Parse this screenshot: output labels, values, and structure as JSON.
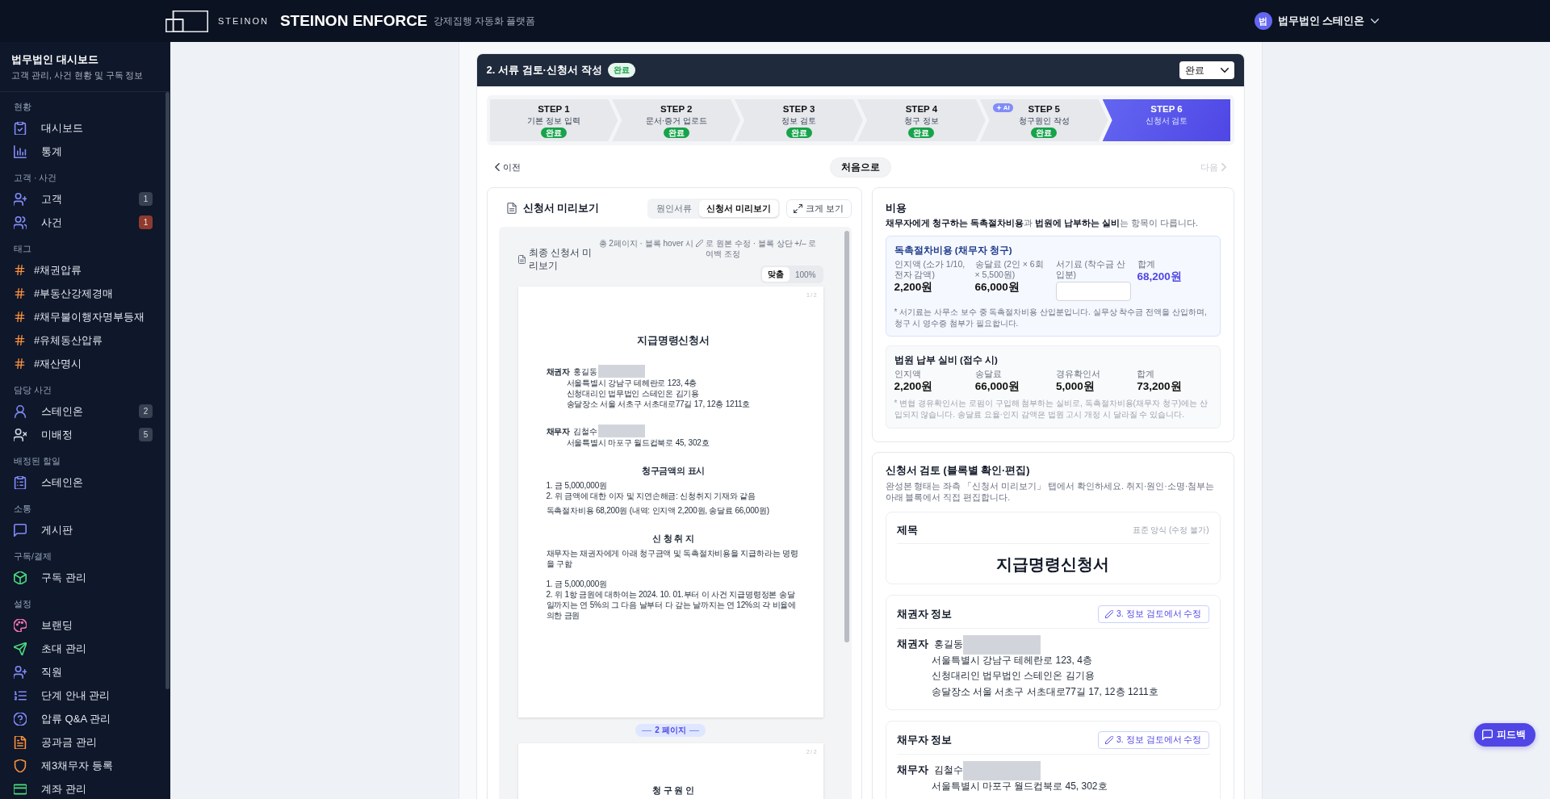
{
  "topbar": {
    "brand": "STEINON",
    "product": "STEINON ENFORCE",
    "tagline": "강제집행 자동화 플랫폼",
    "user": {
      "initial": "법",
      "name": "법무법인 스테인온"
    }
  },
  "sidebar": {
    "title": "법무법인 대시보드",
    "subtitle": "고객 관리, 사건 현황 및 구독 정보",
    "sections": [
      {
        "heading": "현황",
        "items": [
          {
            "kind": "dashboard",
            "label": "대시보드",
            "selected": false
          },
          {
            "kind": "stats",
            "label": "통계",
            "selected": false
          }
        ]
      },
      {
        "heading": "고객 · 사건",
        "items": [
          {
            "kind": "clients",
            "label": "고객",
            "selected": false,
            "badge": {
              "text": "1",
              "kind": "neutral"
            }
          },
          {
            "kind": "cases",
            "label": "사건",
            "selected": false,
            "badge": {
              "text": "1",
              "kind": "alert"
            }
          }
        ]
      },
      {
        "heading": "태그",
        "items": [
          {
            "kind": "tag",
            "label": "#채권압류",
            "selected": false
          },
          {
            "kind": "tag",
            "label": "#부동산강제경매",
            "selected": false
          },
          {
            "kind": "tag",
            "label": "#채무불이행자명부등재",
            "selected": false
          },
          {
            "kind": "tag",
            "label": "#유체동산압류",
            "selected": false
          },
          {
            "kind": "tag",
            "label": "#재산명시",
            "selected": false
          }
        ]
      },
      {
        "heading": "담당 사건",
        "items": [
          {
            "kind": "assignee",
            "label": "스테인온",
            "selected": false,
            "badge": {
              "text": "2",
              "kind": "neutral"
            }
          },
          {
            "kind": "unassigned",
            "label": "미배정",
            "selected": false,
            "badge": {
              "text": "5",
              "kind": "neutral"
            }
          }
        ]
      },
      {
        "heading": "배정된 할일",
        "items": [
          {
            "kind": "tasks",
            "label": "스테인온",
            "selected": false
          }
        ]
      },
      {
        "heading": "소통",
        "items": [
          {
            "kind": "board",
            "label": "게시판",
            "selected": false
          }
        ]
      },
      {
        "heading": "구독/결제",
        "items": [
          {
            "kind": "subscription",
            "label": "구독 관리",
            "selected": false
          }
        ]
      },
      {
        "heading": "설정",
        "items": [
          {
            "kind": "branding",
            "label": "브랜딩",
            "selected": false
          },
          {
            "kind": "invite",
            "label": "초대 관리",
            "selected": false
          },
          {
            "kind": "staff",
            "label": "직원",
            "selected": false
          },
          {
            "kind": "step-guide",
            "label": "단계 안내 관리",
            "selected": false
          },
          {
            "kind": "qa",
            "label": "압류 Q&A 관리",
            "selected": false
          },
          {
            "kind": "bills",
            "label": "공과금 관리",
            "selected": false
          },
          {
            "kind": "third-debtor",
            "label": "제3채무자 등록",
            "selected": false
          },
          {
            "kind": "accounts",
            "label": "계좌 관리",
            "selected": false
          }
        ]
      }
    ]
  },
  "workflow": {
    "title": "2. 서류 검토·신청서 작성",
    "status_badge": "완료",
    "status_select": {
      "value": "완료"
    },
    "steps": [
      {
        "label": "STEP 1",
        "title": "기본 정보 입력",
        "status": "완료",
        "selected": false
      },
      {
        "label": "STEP 2",
        "title": "문서·증거 업로드",
        "status": "완료",
        "selected": false
      },
      {
        "label": "STEP 3",
        "title": "정보 검토",
        "status": "완료",
        "selected": false
      },
      {
        "label": "STEP 4",
        "title": "청구 정보",
        "status": "완료",
        "selected": false
      },
      {
        "label": "STEP 5",
        "title": "청구원인 작성",
        "status": "완료",
        "selected": false,
        "ai_tag": "AI"
      },
      {
        "label": "STEP 6",
        "title": "신청서 검토",
        "selected": true
      }
    ],
    "nav": {
      "prev": {
        "label": "이전",
        "disabled": false
      },
      "home": {
        "label": "처음으로"
      },
      "next": {
        "label": "다음",
        "disabled": true
      }
    }
  },
  "preview_panel": {
    "title": "신청서 미리보기",
    "view_tabs": [
      {
        "label": "원인서류",
        "selected": false
      },
      {
        "label": "신청서 미리보기",
        "selected": true
      }
    ],
    "expand_button": "크게 보기",
    "preview": {
      "title": "최종 신청서 미리보기",
      "hint_before": "총 2페이지 · 블록 hover 시",
      "hint_after": "로 원본 수정 · 블록 상단 +/– 로 여백 조정",
      "zoom": [
        {
          "label": "맞춤",
          "selected": true
        },
        {
          "label": "100%",
          "selected": false
        }
      ],
      "pages": [
        {
          "number": "1 / 2",
          "blocks": [
            {
              "kind": "title",
              "text": "지급명령신청서"
            },
            {
              "kind": "party",
              "role": "채권자",
              "name": "홍길동",
              "redacted": true,
              "lines": [
                "서울특별시 강남구 테헤란로 123, 4층",
                "신청대리인 법무법인 스테인온 김기용",
                "송달장소 서울 서초구 서초대로77길 17, 12층 1211호"
              ]
            },
            {
              "kind": "party",
              "role": "채무자",
              "name": "김철수",
              "redacted": true,
              "lines": [
                "서울특별시 마포구 월드컵북로 45, 302호"
              ]
            },
            {
              "kind": "heading",
              "text": "청구금액의 표시"
            },
            {
              "kind": "lines",
              "lines": [
                "1. 금 5,000,000원",
                "2. 위 금액에 대한 이자 및 지연손해금: 신청취지 기재와 같음"
              ]
            },
            {
              "kind": "paragraph",
              "text": "독촉절차비용 68,200원 (내역: 인지액 2,200원, 송달료 66,000원)"
            },
            {
              "kind": "heading",
              "text": "신 청 취 지"
            },
            {
              "kind": "paragraph",
              "text": "채무자는 채권자에게 아래 청구금액 및 독촉절차비용을 지급하라는 명령을 구함"
            },
            {
              "kind": "lines",
              "lines": [
                "1. 금 5,000,000원",
                "2. 위 1항 금원에 대하여는 2024. 10. 01.부터 이 사건 지급명령정본 송달일까지는 연 5%의 그 다음 날부터 다 갚는 날까지는 연 12%의 각 비율에 의한 금원"
              ]
            }
          ]
        },
        {
          "number": "2 / 2",
          "divider_before": "2 페이지",
          "blocks": [
            {
              "kind": "heading",
              "text": "청 구 원 인"
            }
          ]
        }
      ]
    }
  },
  "cost_panel": {
    "title": "비용",
    "description": "**채무자에게 청구하는 독촉절차비용**과 **법원에 납부하는 실비**는 항목이 다릅니다.",
    "groups": [
      {
        "kind": "claim",
        "title": "독촉절차비용 (채무자 청구)",
        "items": [
          {
            "kind": "value",
            "label": "인지액 (소가 1/10, 전자 감액)",
            "value": "2,200원"
          },
          {
            "kind": "value",
            "label": "송달료 (2인 × 6회 × 5,500원)",
            "value": "66,000원"
          },
          {
            "kind": "input",
            "label": "서기료 (착수금 산입분)"
          },
          {
            "kind": "total",
            "label": "합계",
            "value": "68,200원"
          }
        ],
        "note": "* 서기료는 사무소 보수 중 독촉절차비용 산입분입니다. 실무상 착수금 전액을 산입하며, 청구 시 영수증 첨부가 필요합니다."
      },
      {
        "kind": "court",
        "title": "법원 납부 실비 (접수 시)",
        "items": [
          {
            "kind": "value",
            "label": "인지액",
            "value": "2,200원"
          },
          {
            "kind": "value",
            "label": "송달료",
            "value": "66,000원"
          },
          {
            "kind": "value",
            "label": "경유확인서",
            "value": "5,000원"
          },
          {
            "kind": "value",
            "label": "합계",
            "value": "73,200원"
          }
        ],
        "note": "* 변협 경유확인서는 로펌이 구입해 첨부하는 실비로, 독촉절차비용(채무자 청구)에는 산입되지 않습니다. 송달료 요율·인지 감액은 법원 고시 개정 시 달라질 수 있습니다."
      }
    ]
  },
  "review_panel": {
    "title": "신청서 검토 (블록별 확인·편집)",
    "description": "완성본 형태는 좌측 「신청서 미리보기」 탭에서 확인하세요. 취지·원인·소명·첨부는 아래 블록에서 직접 편집합니다.",
    "blocks": [
      {
        "kind": "title",
        "heading": "제목",
        "note": "표준 양식 (수정 불가)",
        "text": "지급명령신청서"
      },
      {
        "kind": "party",
        "heading": "채권자 정보",
        "edit_button": "3. 정보 검토에서 수정",
        "role": "채권자",
        "name": "홍길동",
        "redacted": true,
        "lines": [
          "서울특별시 강남구 테헤란로 123, 4층",
          "신청대리인 법무법인 스테인온 김기용",
          "송달장소 서울 서초구 서초대로77길 17, 12층 1211호"
        ]
      },
      {
        "kind": "party",
        "heading": "채무자 정보",
        "edit_button": "3. 정보 검토에서 수정",
        "role": "채무자",
        "name": "김철수",
        "redacted": true,
        "lines": [
          "서울특별시 마포구 월드컵북로 45, 302호"
        ]
      }
    ]
  },
  "feedback_button": "피드백"
}
